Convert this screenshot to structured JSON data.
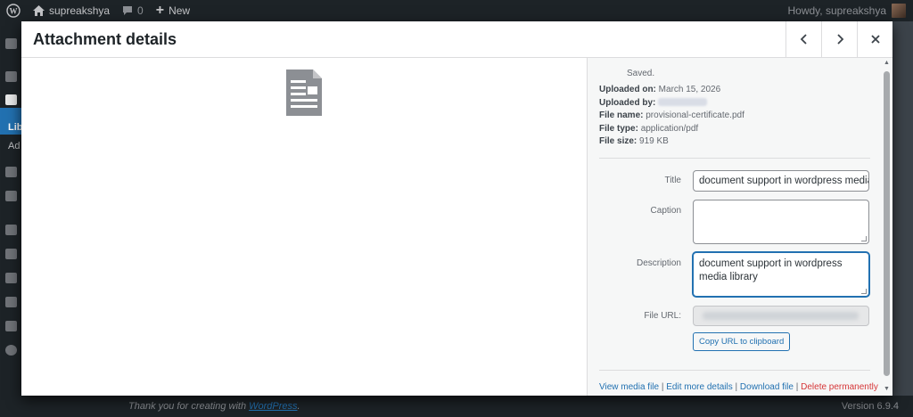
{
  "adminbar": {
    "site_name": "supreakshya",
    "comments_count": "0",
    "new_label": "New",
    "greeting": "Howdy, supreakshya"
  },
  "adminmenu": {
    "library_label": "Lib",
    "add_label": "Ad"
  },
  "footer": {
    "thanks_text": "Thank you for creating with",
    "wp_link": "WordPress",
    "thanks_suffix": ".",
    "version": "Version 6.9.4"
  },
  "modal": {
    "title": "Attachment details",
    "prev_icon": "chevron-left-icon",
    "next_icon": "chevron-right-icon",
    "close_icon": "close-icon"
  },
  "details": {
    "saved_text": "Saved.",
    "uploaded_on_label": "Uploaded on:",
    "uploaded_on_value": "March 15, 2026",
    "uploaded_by_label": "Uploaded by:",
    "file_name_label": "File name:",
    "file_name_value": "provisional-certificate.pdf",
    "file_type_label": "File type:",
    "file_type_value": "application/pdf",
    "file_size_label": "File size:",
    "file_size_value": "919 KB"
  },
  "fields": {
    "title_label": "Title",
    "title_value": "document support in wordpress media library",
    "caption_label": "Caption",
    "caption_value": "",
    "description_label": "Description",
    "description_value": "document support in wordpress media library",
    "file_url_label": "File URL:",
    "copy_button": "Copy URL to clipboard"
  },
  "actions": {
    "view_media": "View media file",
    "edit_more": "Edit more details",
    "download": "Download file",
    "delete": "Delete permanently",
    "separator": "|"
  },
  "colors": {
    "accent": "#2271b1",
    "danger": "#d63638",
    "adminbar_bg": "#1d2327"
  }
}
